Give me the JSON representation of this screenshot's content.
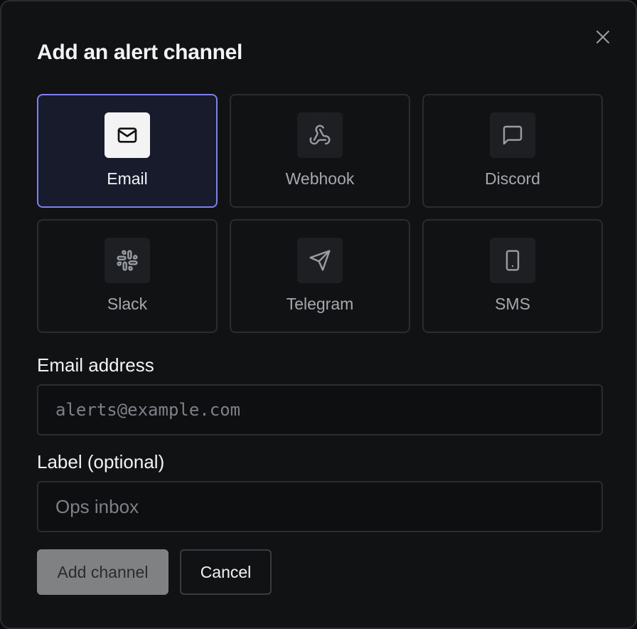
{
  "dialog": {
    "title": "Add an alert channel"
  },
  "channels": [
    {
      "label": "Email",
      "icon": "mail-icon",
      "selected": true
    },
    {
      "label": "Webhook",
      "icon": "webhook-icon",
      "selected": false
    },
    {
      "label": "Discord",
      "icon": "message-square-icon",
      "selected": false
    },
    {
      "label": "Slack",
      "icon": "slack-icon",
      "selected": false
    },
    {
      "label": "Telegram",
      "icon": "send-icon",
      "selected": false
    },
    {
      "label": "SMS",
      "icon": "smartphone-icon",
      "selected": false
    }
  ],
  "form": {
    "email_label": "Email address",
    "email_placeholder": "alerts@example.com",
    "email_value": "",
    "label_label": "Label (optional)",
    "label_placeholder": "Ops inbox",
    "label_value": ""
  },
  "actions": {
    "primary_label": "Add channel",
    "secondary_label": "Cancel"
  },
  "colors": {
    "accent": "#7b82ec",
    "selected_bg": "#181b2b",
    "surface": "#111214",
    "border": "#2a2c30"
  }
}
